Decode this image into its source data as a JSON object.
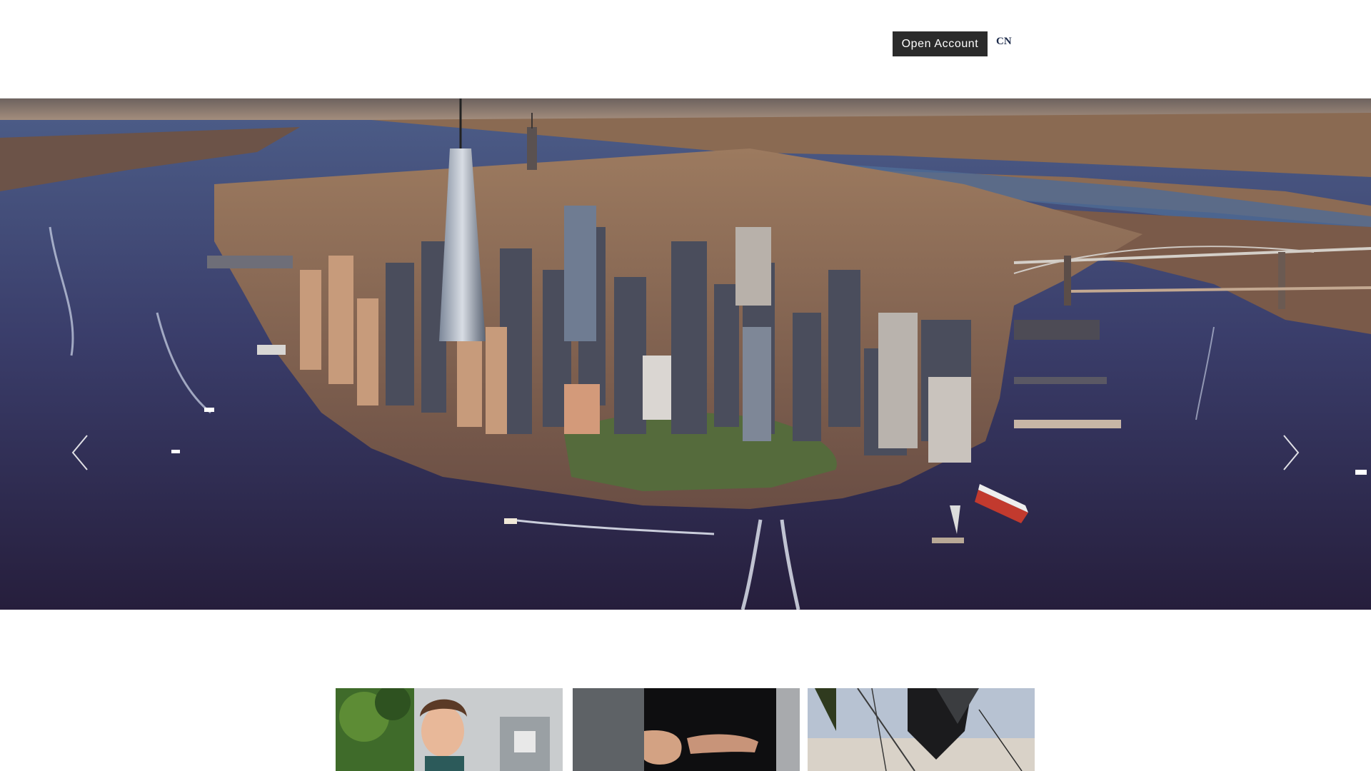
{
  "header": {
    "open_account_label": "Open Account",
    "language_label": "CN"
  },
  "hero": {
    "image": "aerial-manhattan-skyline-photo",
    "prev_icon": "chevron-left-icon",
    "next_icon": "chevron-right-icon"
  },
  "cards": [
    {
      "image": "smiling-person-photo"
    },
    {
      "image": "hands-gesturing-photo"
    },
    {
      "image": "sailboat-rigging-photo"
    }
  ],
  "colors": {
    "button_bg": "#2b2b2b",
    "button_text": "#ffffff",
    "lang_link": "#1c2a4a",
    "water": "#2e2a4d",
    "sky": "#8a7a72"
  }
}
